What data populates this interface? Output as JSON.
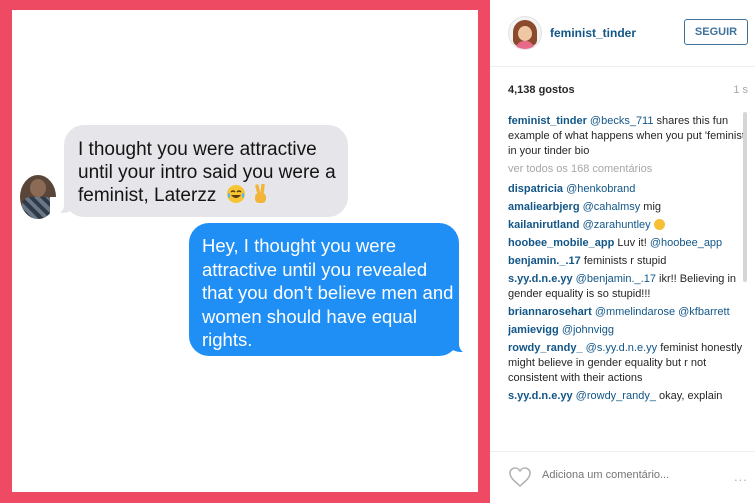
{
  "photo": {
    "grey_message": "I thought you were attractive until your intro said you were a feminist, Laterzz",
    "blue_message": "Hey, I thought you were attractive until you revealed that you don't believe men and women should have equal rights."
  },
  "header": {
    "username": "feminist_tinder",
    "follow_label": "SEGUIR"
  },
  "stats": {
    "likes": "4,138 gostos",
    "time": "1 s"
  },
  "caption": {
    "user": "feminist_tinder",
    "mention": "@becks_711",
    "text": " shares this fun example of what happens when you put 'feminist' in your tinder bio"
  },
  "view_all": "ver todos os 168 comentários",
  "comments": [
    {
      "user": "dispatricia",
      "mention": "@henkobrand",
      "text": ""
    },
    {
      "user": "amaliearbjerg",
      "mention": "@cahalmsy",
      "text": " mig"
    },
    {
      "user": "kailanirutland",
      "mention": "@zarahuntley",
      "text": " "
    },
    {
      "user": "hoobee_mobile_app",
      "mention": "",
      "text": " Luv it! ",
      "mention2": "@hoobee_app"
    },
    {
      "user": "benjamin._.17",
      "mention": "",
      "text": " feminists r stupid"
    },
    {
      "user": "s.yy.d.n.e.yy",
      "mention": "@benjamin._.17",
      "text": " ikr!! Believing in gender equality is so stupid!!!"
    },
    {
      "user": "briannarosehart",
      "mention": "@mmelindarose",
      "text": " ",
      "mention2": "@kfbarrett"
    },
    {
      "user": "jamievigg",
      "mention": "@johnvigg",
      "text": ""
    },
    {
      "user": "rowdy_randy_",
      "mention": "@s.yy.d.n.e.yy",
      "text": " feminist honestly might believe in gender equality but r not consistent with their actions"
    },
    {
      "user": "s.yy.d.n.e.yy",
      "mention": "@rowdy_randy_",
      "text": " okay, explain"
    }
  ],
  "footer": {
    "comment_placeholder": "Adiciona um comentário...",
    "more": "..."
  },
  "colors": {
    "frame": "#ee4a64",
    "blue_bubble": "#1f8ff5",
    "grey_bubble": "#e5e5ea",
    "link": "#125688"
  },
  "icons": [
    "tears-of-joy-emoji",
    "victory-hand-emoji",
    "grimacing-emoji",
    "heart-icon",
    "more-icon"
  ]
}
